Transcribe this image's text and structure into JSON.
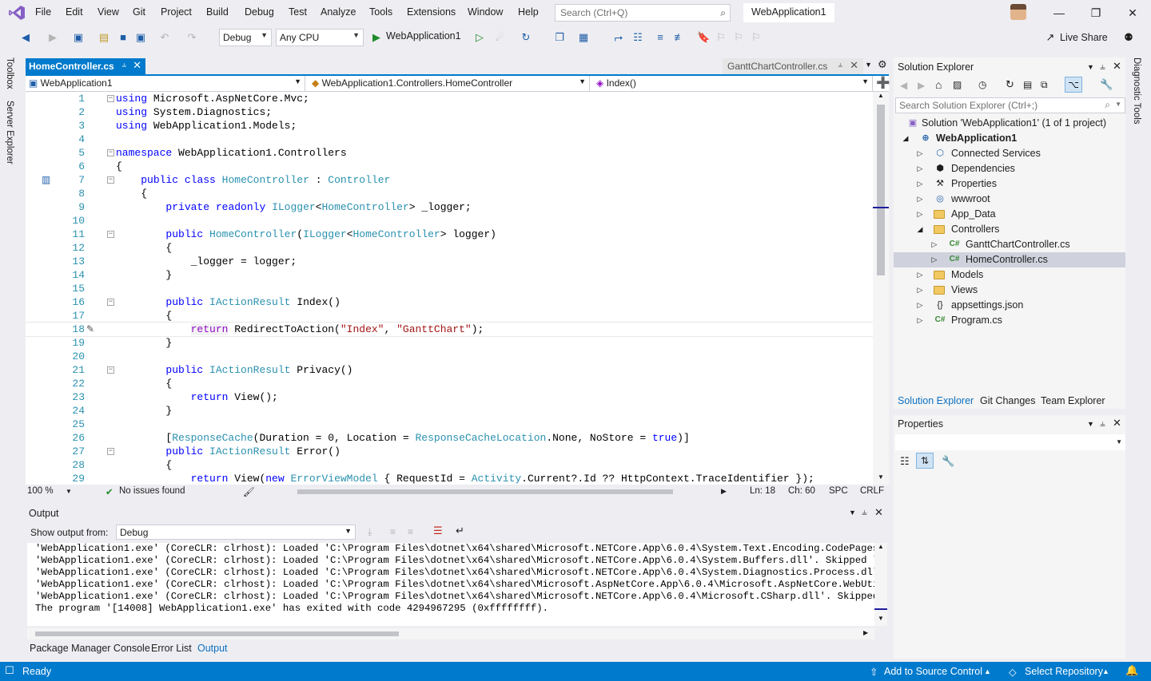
{
  "menu": [
    "File",
    "Edit",
    "View",
    "Git",
    "Project",
    "Build",
    "Debug",
    "Test",
    "Analyze",
    "Tools",
    "Extensions",
    "Window",
    "Help"
  ],
  "search": {
    "placeholder": "Search (Ctrl+Q)"
  },
  "solution_title": "WebApplication1",
  "window_controls": {
    "minimize": "—",
    "restore": "❐",
    "close": "✕"
  },
  "toolbar": {
    "config": "Debug",
    "platform": "Any CPU",
    "run_target": "WebApplication1",
    "live_share": "Live Share"
  },
  "left_tabs": {
    "toolbox": "Toolbox",
    "server_explorer": "Server Explorer"
  },
  "right_tabs": {
    "diagnostic": "Diagnostic Tools"
  },
  "editor": {
    "active_tab": "HomeController.cs",
    "preview_tab": "GanttChartController.cs",
    "nav": {
      "project": "WebApplication1",
      "class": "WebApplication1.Controllers.HomeController",
      "member": "Index()"
    },
    "lines": [
      {
        "n": "1",
        "t": "using Microsoft.AspNetCore.Mvc;"
      },
      {
        "n": "2",
        "t": "using System.Diagnostics;"
      },
      {
        "n": "3",
        "t": "using WebApplication1.Models;"
      },
      {
        "n": "4",
        "t": ""
      },
      {
        "n": "5",
        "t": "namespace WebApplication1.Controllers"
      },
      {
        "n": "6",
        "t": "{"
      },
      {
        "n": "7",
        "t": "    public class HomeController : Controller"
      },
      {
        "n": "8",
        "t": "    {"
      },
      {
        "n": "9",
        "t": "        private readonly ILogger<HomeController> _logger;"
      },
      {
        "n": "10",
        "t": ""
      },
      {
        "n": "11",
        "t": "        public HomeController(ILogger<HomeController> logger)"
      },
      {
        "n": "12",
        "t": "        {"
      },
      {
        "n": "13",
        "t": "            _logger = logger;"
      },
      {
        "n": "14",
        "t": "        }"
      },
      {
        "n": "15",
        "t": ""
      },
      {
        "n": "16",
        "t": "        public IActionResult Index()"
      },
      {
        "n": "17",
        "t": "        {"
      },
      {
        "n": "18",
        "t": "            return RedirectToAction(\"Index\", \"GanttChart\");"
      },
      {
        "n": "19",
        "t": "        }"
      },
      {
        "n": "20",
        "t": ""
      },
      {
        "n": "21",
        "t": "        public IActionResult Privacy()"
      },
      {
        "n": "22",
        "t": "        {"
      },
      {
        "n": "23",
        "t": "            return View();"
      },
      {
        "n": "24",
        "t": "        }"
      },
      {
        "n": "25",
        "t": ""
      },
      {
        "n": "26",
        "t": "        [ResponseCache(Duration = 0, Location = ResponseCacheLocation.None, NoStore = true)]"
      },
      {
        "n": "27",
        "t": "        public IActionResult Error()"
      },
      {
        "n": "28",
        "t": "        {"
      },
      {
        "n": "29",
        "t": "            return View(new ErrorViewModel { RequestId = Activity.Current?.Id ?? HttpContext.TraceIdentifier });"
      }
    ],
    "status": {
      "zoom": "100 %",
      "issues": "No issues found",
      "ln": "Ln: 18",
      "ch": "Ch: 60",
      "spc": "SPC",
      "crlf": "CRLF"
    }
  },
  "output": {
    "title": "Output",
    "show_from_label": "Show output from:",
    "source": "Debug",
    "lines": [
      "'WebApplication1.exe' (CoreCLR: clrhost): Loaded 'C:\\Program Files\\dotnet\\x64\\shared\\Microsoft.NETCore.App\\6.0.4\\System.Text.Encoding.CodePages.dll'.",
      "'WebApplication1.exe' (CoreCLR: clrhost): Loaded 'C:\\Program Files\\dotnet\\x64\\shared\\Microsoft.NETCore.App\\6.0.4\\System.Buffers.dll'. Skipped loading",
      "'WebApplication1.exe' (CoreCLR: clrhost): Loaded 'C:\\Program Files\\dotnet\\x64\\shared\\Microsoft.NETCore.App\\6.0.4\\System.Diagnostics.Process.dll'. Skip",
      "'WebApplication1.exe' (CoreCLR: clrhost): Loaded 'C:\\Program Files\\dotnet\\x64\\shared\\Microsoft.AspNetCore.App\\6.0.4\\Microsoft.AspNetCore.WebUtilities.",
      "'WebApplication1.exe' (CoreCLR: clrhost): Loaded 'C:\\Program Files\\dotnet\\x64\\shared\\Microsoft.NETCore.App\\6.0.4\\Microsoft.CSharp.dll'. Skipped loadin",
      "The program '[14008] WebApplication1.exe' has exited with code 4294967295 (0xffffffff)."
    ],
    "bottom_tabs": [
      "Package Manager Console",
      "Error List",
      "Output"
    ]
  },
  "solution_explorer": {
    "title": "Solution Explorer",
    "search_placeholder": "Search Solution Explorer (Ctrl+;)",
    "solution": "Solution 'WebApplication1' (1 of 1 project)",
    "project": "WebApplication1",
    "items": [
      {
        "label": "Connected Services",
        "icon": "connected-services-icon"
      },
      {
        "label": "Dependencies",
        "icon": "dependencies-icon"
      },
      {
        "label": "Properties",
        "icon": "wrench-icon"
      },
      {
        "label": "wwwroot",
        "icon": "globe-icon"
      },
      {
        "label": "App_Data",
        "icon": "folder-icon"
      },
      {
        "label": "Controllers",
        "icon": "folder-icon"
      },
      {
        "label": "GanttChartController.cs",
        "icon": "csharp-file-icon"
      },
      {
        "label": "HomeController.cs",
        "icon": "csharp-file-icon"
      },
      {
        "label": "Models",
        "icon": "folder-icon"
      },
      {
        "label": "Views",
        "icon": "folder-icon"
      },
      {
        "label": "appsettings.json",
        "icon": "json-file-icon"
      },
      {
        "label": "Program.cs",
        "icon": "csharp-file-icon"
      }
    ],
    "tabs": [
      "Solution Explorer",
      "Git Changes",
      "Team Explorer"
    ]
  },
  "properties": {
    "title": "Properties"
  },
  "statusbar": {
    "ready": "Ready",
    "source_control": "Add to Source Control",
    "repository": "Select Repository"
  },
  "colors": {
    "accent": "#007acc",
    "keyword": "#0000ff",
    "type": "#2b91af",
    "string": "#a31515"
  }
}
